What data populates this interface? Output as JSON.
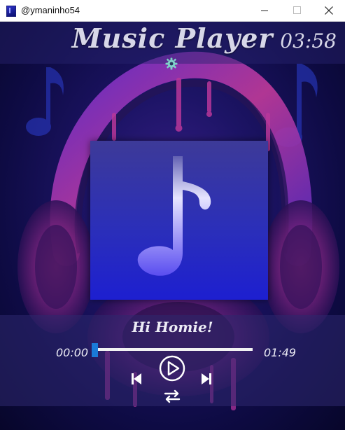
{
  "window": {
    "title": "@ymaninho54",
    "icons": {
      "app": "music-app-icon",
      "minimize": "minimize-icon",
      "maximize": "maximize-icon",
      "close": "close-icon"
    }
  },
  "header": {
    "title": "Music Player",
    "clock": "03:58",
    "settings_icon": "gear-icon"
  },
  "album_art": {
    "icon": "music-note-icon"
  },
  "player": {
    "song_title": "Hi Homie!",
    "current_time": "00:00",
    "total_time": "01:49",
    "progress": 0.0,
    "controls": {
      "play": "play-icon",
      "previous": "skip-previous-icon",
      "next": "skip-next-icon",
      "repeat": "repeat-icon"
    }
  },
  "colors": {
    "accent": "#1a7ad8",
    "text": "#ececf5",
    "background": "#0d0a3a"
  }
}
